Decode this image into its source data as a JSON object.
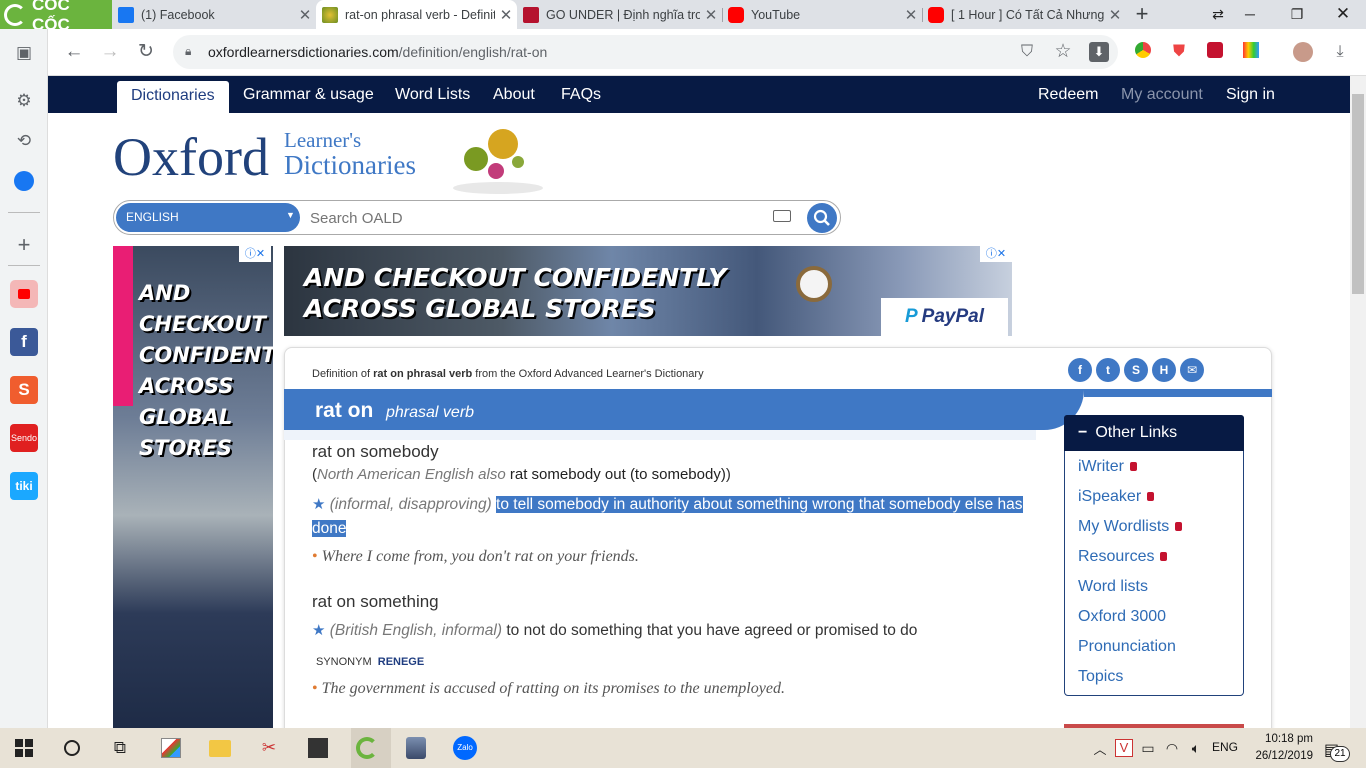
{
  "browser": {
    "name": "CỐC CỐC",
    "tabs": [
      {
        "title": "(1) Facebook",
        "icon": "facebook-icon",
        "color": "#1877f2"
      },
      {
        "title": "rat-on phrasal verb - Definiti",
        "icon": "oxford-dictionary-icon",
        "color": "#c8a020"
      },
      {
        "title": "GO UNDER | Định nghĩa tro",
        "icon": "cambridge-shield-icon",
        "color": "#b5122e"
      },
      {
        "title": "YouTube",
        "icon": "youtube-icon",
        "color": "#ff0000"
      },
      {
        "title": "[ 1 Hour ] Có Tất Cả Nhưng",
        "icon": "youtube-icon",
        "color": "#ff0000"
      }
    ],
    "url_domain": "oxfordlearnersdictionaries.com",
    "url_path": "/definition/english/rat-on"
  },
  "site": {
    "nav_left": [
      "Dictionaries",
      "Grammar & usage",
      "Word Lists",
      "About",
      "FAQs"
    ],
    "nav_right": {
      "redeem": "Redeem",
      "account": "My account",
      "signin": "Sign in"
    },
    "logo_main": "Oxford",
    "logo_line1": "Learner's",
    "logo_line2": "Dictionaries",
    "search": {
      "language": "ENGLISH",
      "placeholder": "Search OALD"
    }
  },
  "ads": {
    "left_text": [
      "AND",
      "CHECKOUT",
      "CONFIDENTLY",
      "ACROSS",
      "GLOBAL",
      "STORES"
    ],
    "top_text": [
      "AND CHECKOUT CONFIDENTLY",
      "ACROSS GLOBAL STORES"
    ],
    "brand": "PayPal"
  },
  "entry": {
    "def_prefix": "Definition of",
    "def_word": "rat on phrasal verb",
    "def_suffix": "from the Oxford Advanced Learner's Dictionary",
    "headword": "rat on",
    "pos": "phrasal verb",
    "sense1": {
      "phrase": "rat on somebody",
      "variant_open": "(",
      "variant_label": "North American English also",
      "variant_phrase": "rat somebody out (to somebody)",
      "variant_close": ")",
      "grammar": "(informal, disapproving)",
      "definition": "to tell somebody in authority about something wrong that somebody else has done",
      "example": "Where I come from, you don't rat on your friends."
    },
    "sense2": {
      "phrase": "rat on something",
      "grammar": "(British English, informal)",
      "definition": "to not do something that you have agreed or promised to do",
      "synonym_label": "SYNONYM",
      "synonym": "RENEGE",
      "example": "The government is accused of ratting on its promises to the unemployed."
    }
  },
  "other_links": {
    "title": "Other Links",
    "items": [
      {
        "label": "iWriter",
        "locked": true
      },
      {
        "label": "iSpeaker",
        "locked": true
      },
      {
        "label": "My Wordlists",
        "locked": true
      },
      {
        "label": "Resources",
        "locked": true
      },
      {
        "label": "Word lists",
        "locked": false
      },
      {
        "label": "Oxford 3000",
        "locked": false
      },
      {
        "label": "Pronunciation",
        "locked": false
      },
      {
        "label": "Topics",
        "locked": false
      }
    ]
  },
  "taskbar": {
    "time": "10:18 pm",
    "date": "26/12/2019",
    "language": "ENG",
    "notifications": "21",
    "apps": [
      "task-view-icon",
      "paint-icon",
      "file-explorer-icon",
      "snipping-tool-icon",
      "sticky-notes-icon",
      "coccoc-browser-icon",
      "game-icon",
      "zalo-icon"
    ]
  },
  "colors": {
    "oxford_navy": "#071a44",
    "oxford_blue": "#3f78c5",
    "link": "#2e6bb5",
    "browser_green": "#6bb43e"
  }
}
